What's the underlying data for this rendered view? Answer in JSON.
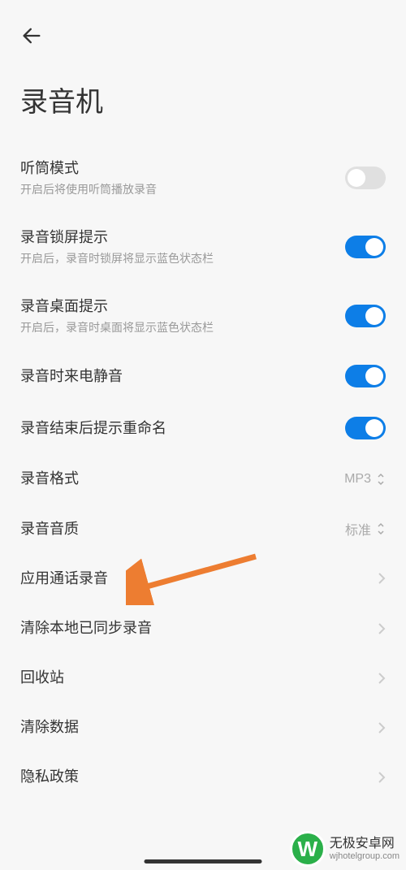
{
  "header": {
    "title": "录音机"
  },
  "settings": {
    "earpiece": {
      "label": "听筒模式",
      "desc": "开启后将使用听筒播放录音",
      "on": false
    },
    "lockscreen": {
      "label": "录音锁屏提示",
      "desc": "开启后，录音时锁屏将显示蓝色状态栏",
      "on": true
    },
    "desktop": {
      "label": "录音桌面提示",
      "desc": "开启后，录音时桌面将显示蓝色状态栏",
      "on": true
    },
    "silent_call": {
      "label": "录音时来电静音",
      "on": true
    },
    "rename_prompt": {
      "label": "录音结束后提示重命名",
      "on": true
    },
    "format": {
      "label": "录音格式",
      "value": "MP3"
    },
    "quality": {
      "label": "录音音质",
      "value": "标准"
    },
    "app_call": {
      "label": "应用通话录音"
    },
    "clear_synced": {
      "label": "清除本地已同步录音"
    },
    "recycle": {
      "label": "回收站"
    },
    "clear_data": {
      "label": "清除数据"
    },
    "privacy": {
      "label": "隐私政策"
    }
  },
  "watermark": {
    "logo_letter": "W",
    "title": "无极安卓网",
    "url": "wjhotelgroup.com"
  }
}
